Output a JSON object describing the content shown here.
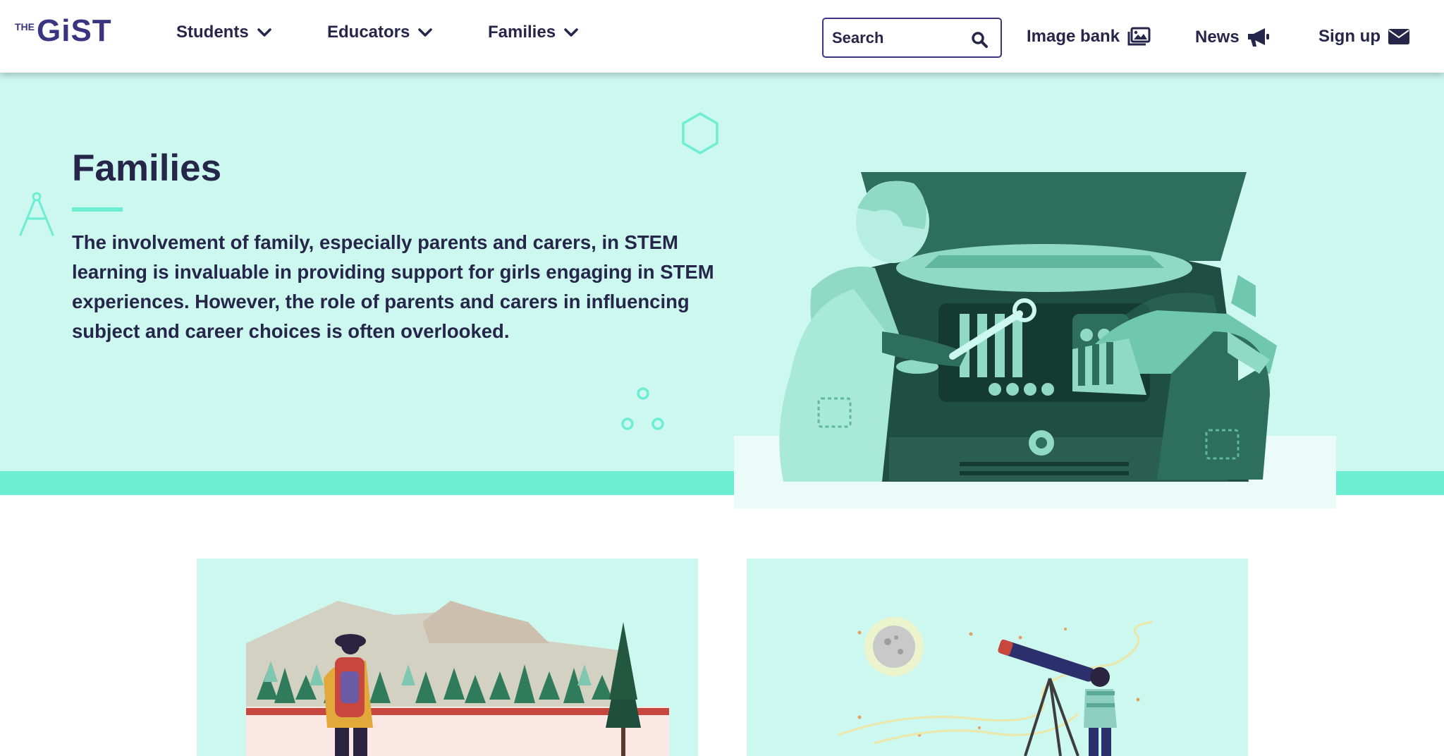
{
  "header": {
    "logo": {
      "prefix": "THE",
      "name": "GiST"
    },
    "nav": [
      {
        "label": "Students"
      },
      {
        "label": "Educators"
      },
      {
        "label": "Families"
      }
    ],
    "search": {
      "placeholder": "Search"
    },
    "utility": {
      "image_bank": "Image bank",
      "news": "News",
      "sign_up": "Sign up"
    }
  },
  "hero": {
    "title": "Families",
    "description": "The involvement of family, especially parents and carers, in STEM learning is invaluable in providing support for girls engaging in STEM experiences. However, the role of parents and carers in influencing subject and career choices is often overlooked."
  },
  "icons": {
    "caret": "chevron-down-icon",
    "search": "search-icon",
    "image_bank": "images-icon",
    "news": "megaphone-icon",
    "sign_up": "envelope-icon"
  },
  "colors": {
    "brand_navy": "#3a3580",
    "text": "#26264a",
    "hero_bg": "#ccf8f0",
    "accent_mint": "#6deed3",
    "illustration_dark": "#2e6e5c"
  }
}
